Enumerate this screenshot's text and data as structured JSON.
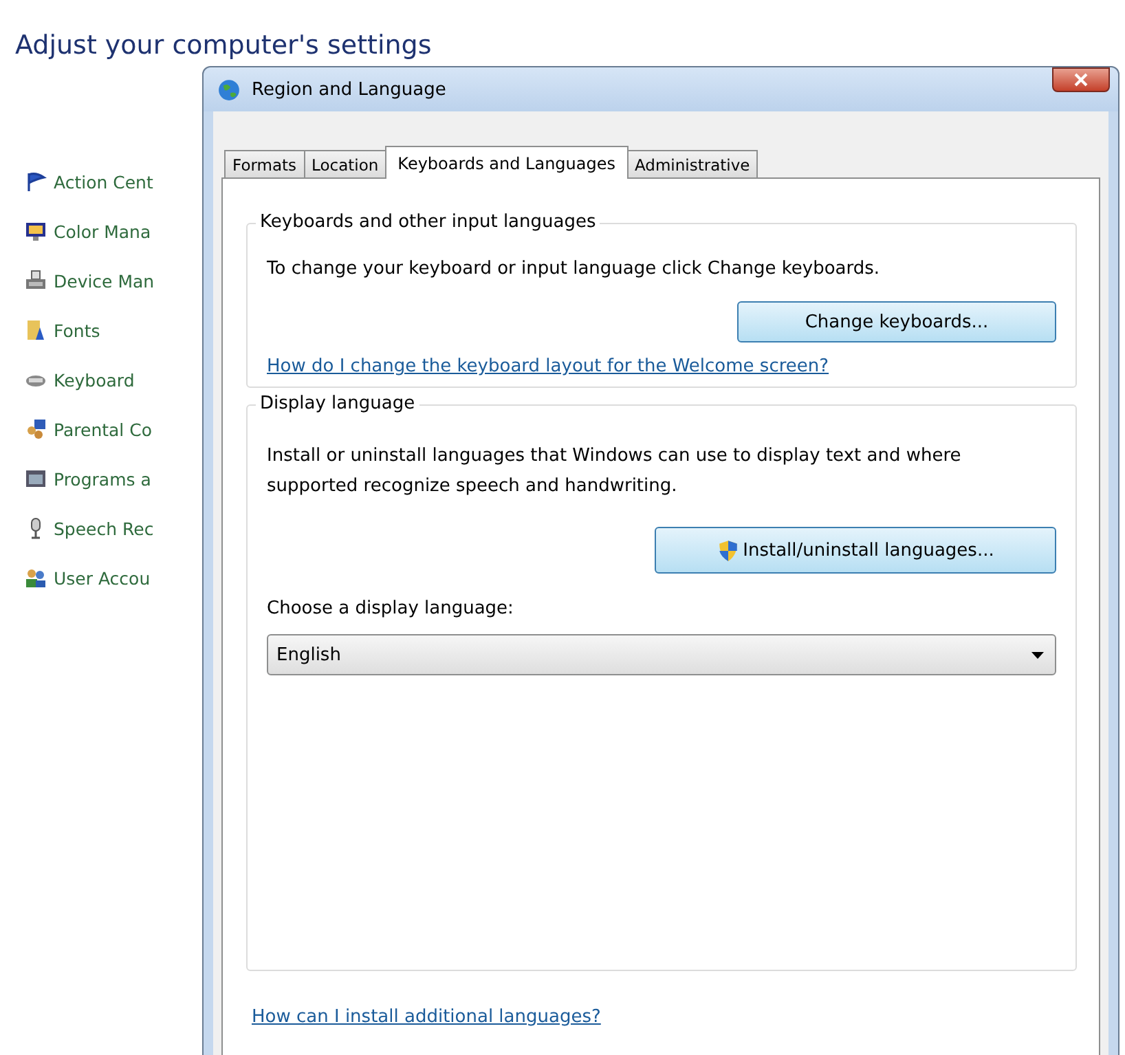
{
  "heading": "Adjust your computer's settings",
  "sidebar": {
    "items": [
      {
        "label": "Action Cent"
      },
      {
        "label": "Color Mana"
      },
      {
        "label": "Device Man"
      },
      {
        "label": "Fonts"
      },
      {
        "label": "Keyboard"
      },
      {
        "label": "Parental Co"
      },
      {
        "label": "Programs a"
      },
      {
        "label": "Speech Rec"
      },
      {
        "label": "User Accou"
      }
    ]
  },
  "dialog": {
    "title": "Region and Language",
    "tabs": [
      {
        "label": "Formats",
        "selected": false
      },
      {
        "label": "Location",
        "selected": false
      },
      {
        "label": "Keyboards and Languages",
        "selected": true
      },
      {
        "label": "Administrative",
        "selected": false
      }
    ],
    "keyboards_group": {
      "legend": "Keyboards and other input languages",
      "text": "To change your keyboard or input language click Change keyboards.",
      "button": "Change keyboards...",
      "link": "How do I change the keyboard layout for the Welcome screen?"
    },
    "display_group": {
      "legend": "Display language",
      "text": "Install or uninstall languages that Windows can use to display text and where supported recognize speech and handwriting.",
      "button": "Install/uninstall languages...",
      "select_label": "Choose a display language:",
      "select_value": "English"
    },
    "footer_link": "How can I install additional languages?"
  }
}
